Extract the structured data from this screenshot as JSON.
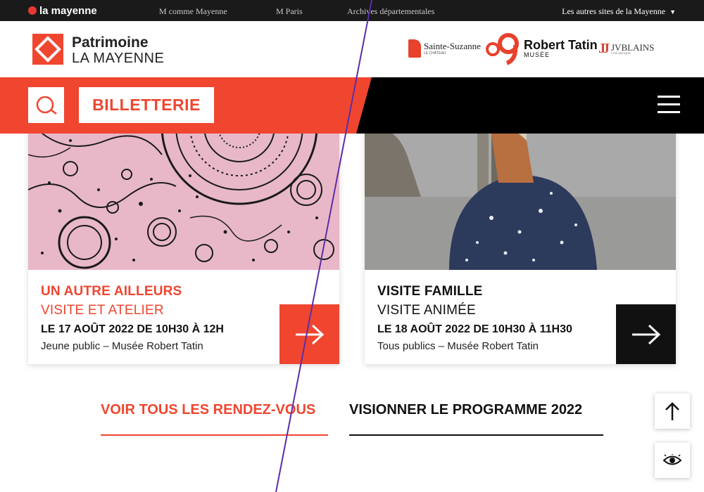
{
  "topbar": {
    "brand": "la mayenne",
    "links": [
      "M comme Mayenne",
      "M Paris",
      "Archives départementales"
    ],
    "other_sites": "Les autres sites de la Mayenne"
  },
  "header": {
    "logo_line1": "Patrimoine",
    "logo_line2": "LA MAYENNE",
    "site_logos": {
      "sainte_suzanne": {
        "name": "Sainte-Suzanne",
        "sub": "LE CHÂTEAU"
      },
      "robert_tatin": {
        "name": "Robert Tatin",
        "sub": "MUSÉE"
      },
      "jublains": {
        "name": "JVBLAINS",
        "sub": "CITÉ ANTIQUE"
      }
    }
  },
  "nav": {
    "ticketing": "BILLETTERIE"
  },
  "cards": [
    {
      "title": "UN AUTRE AILLEURS",
      "kind": "VISITE ET ATELIER",
      "date": "LE 17 AOÛT 2022 DE 10H30 À 12H",
      "meta": "Jeune public – Musée Robert Tatin"
    },
    {
      "title": "VISITE FAMILLE",
      "kind": "VISITE ANIMÉE",
      "date": "LE 18 AOÛT 2022 DE 10H30 À 11H30",
      "meta": "Tous publics – Musée Robert Tatin"
    }
  ],
  "links": {
    "all_events": "VOIR TOUS LES RENDEZ-VOUS",
    "programme": "VISIONNER LE PROGRAMME 2022"
  },
  "colors": {
    "accent": "#f04630",
    "dark": "#111111",
    "topbar": "#1a1a1a"
  }
}
